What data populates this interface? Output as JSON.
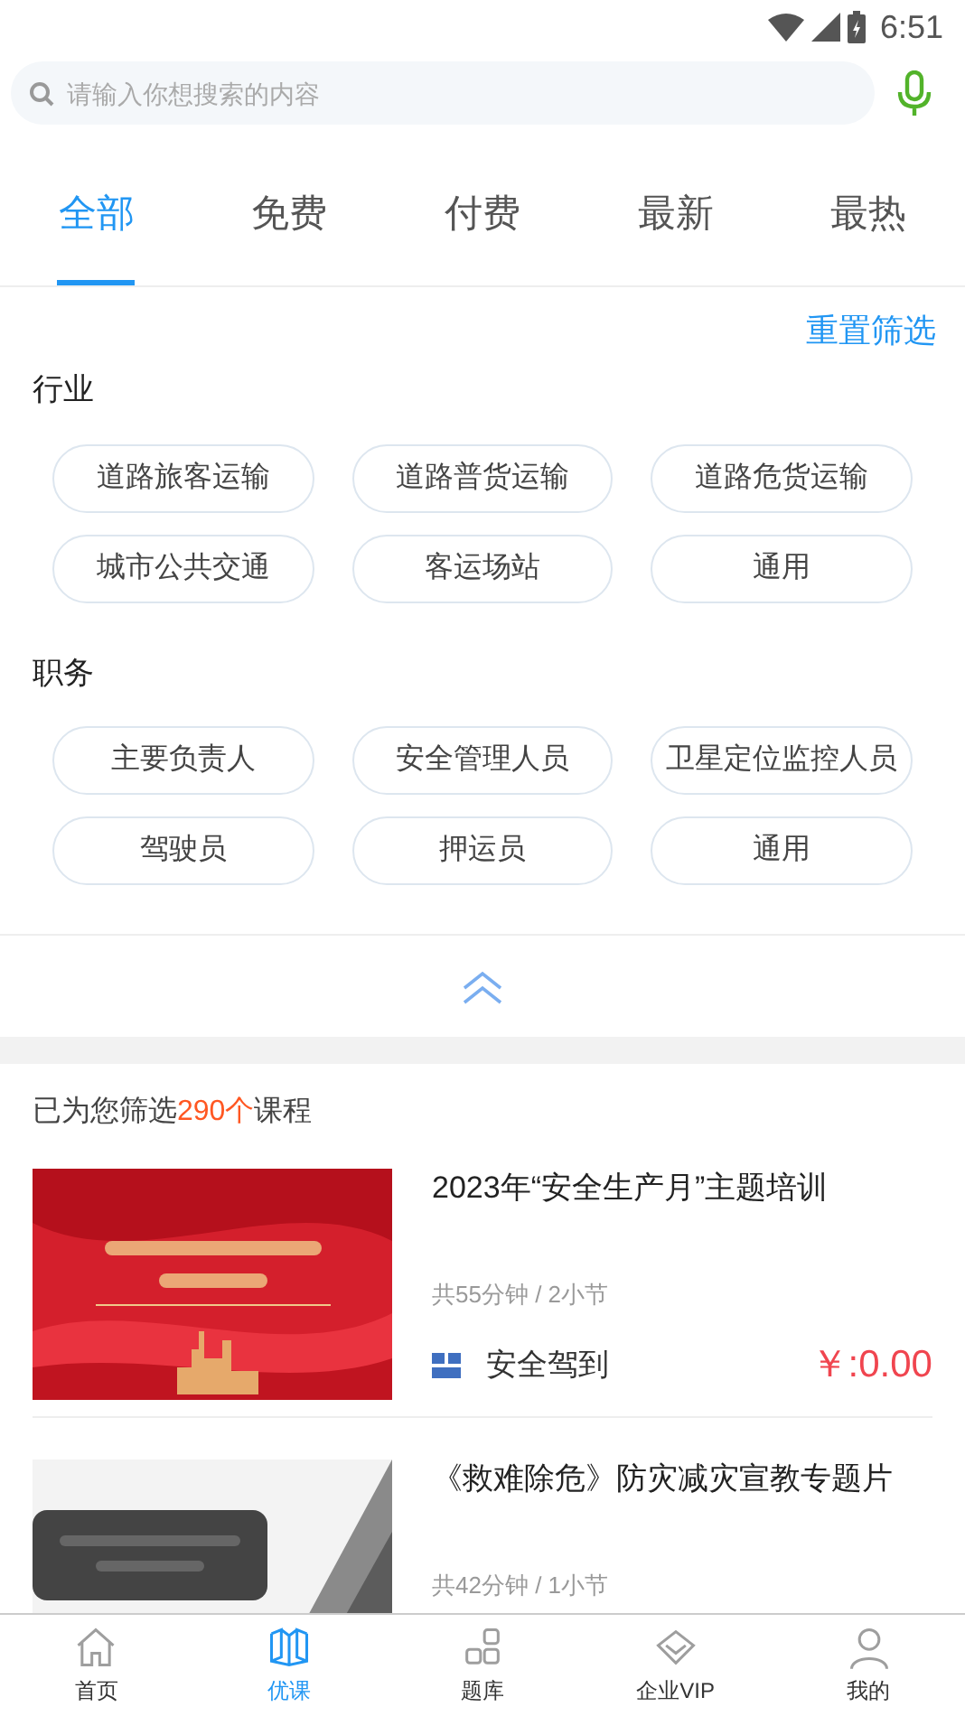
{
  "status_bar": {
    "time": "6:51"
  },
  "search": {
    "placeholder": "请输入你想搜索的内容"
  },
  "tabs": [
    {
      "label": "全部",
      "selected": true
    },
    {
      "label": "免费",
      "selected": false
    },
    {
      "label": "付费",
      "selected": false
    },
    {
      "label": "最新",
      "selected": false
    },
    {
      "label": "最热",
      "selected": false
    }
  ],
  "reset_link": "重置筛选",
  "filter_groups": [
    {
      "title": "行业",
      "options": [
        "道路旅客运输",
        "道路普货运输",
        "道路危货运输",
        "城市公共交通",
        "客运场站",
        "通用"
      ]
    },
    {
      "title": "职务",
      "options": [
        "主要负责人",
        "安全管理人员",
        "卫星定位监控人员",
        "驾驶员",
        "押运员",
        "通用"
      ]
    }
  ],
  "result_summary": {
    "prefix": "已为您筛选",
    "count": "290个",
    "suffix": "课程"
  },
  "courses": [
    {
      "title": "2023年“安全生产月”主题培训",
      "meta": "共55分钟 / 2小节",
      "source": "安全驾到",
      "price": "￥:0.00",
      "kind": "red_picture"
    },
    {
      "title": "《救难除危》防灾减灾宣教专题片",
      "meta": "共42分钟 / 1小节",
      "kind": "gray_picture"
    }
  ],
  "bottom_nav": [
    {
      "label": "首页",
      "kind": "home",
      "selected": false
    },
    {
      "label": "优课",
      "kind": "book",
      "selected": true
    },
    {
      "label": "题库",
      "kind": "grid",
      "selected": false
    },
    {
      "label": "企业VIP",
      "kind": "diamond",
      "selected": false
    },
    {
      "label": "我的",
      "kind": "user",
      "selected": false
    }
  ]
}
